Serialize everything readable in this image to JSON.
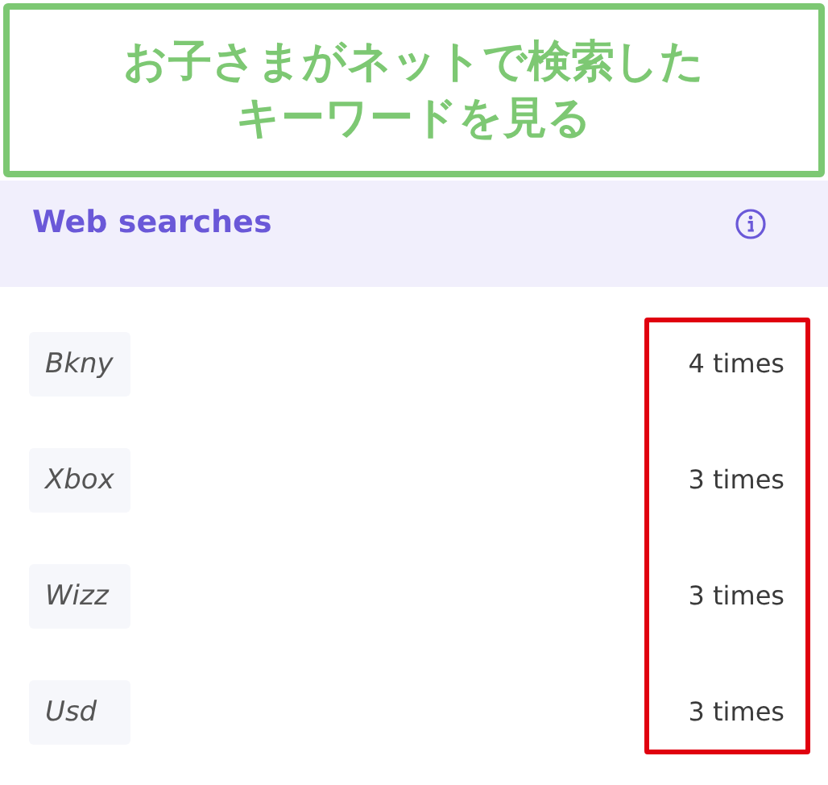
{
  "banner": {
    "lines": [
      "お子さまがネットで検索した",
      "キーワードを見る"
    ]
  },
  "panel": {
    "title": "Web searches"
  },
  "searches": [
    {
      "term": "Bkny",
      "count": "4 times"
    },
    {
      "term": "Xbox",
      "count": "3 times"
    },
    {
      "term": "Wizz",
      "count": "3 times"
    },
    {
      "term": "Usd",
      "count": "3 times"
    }
  ]
}
